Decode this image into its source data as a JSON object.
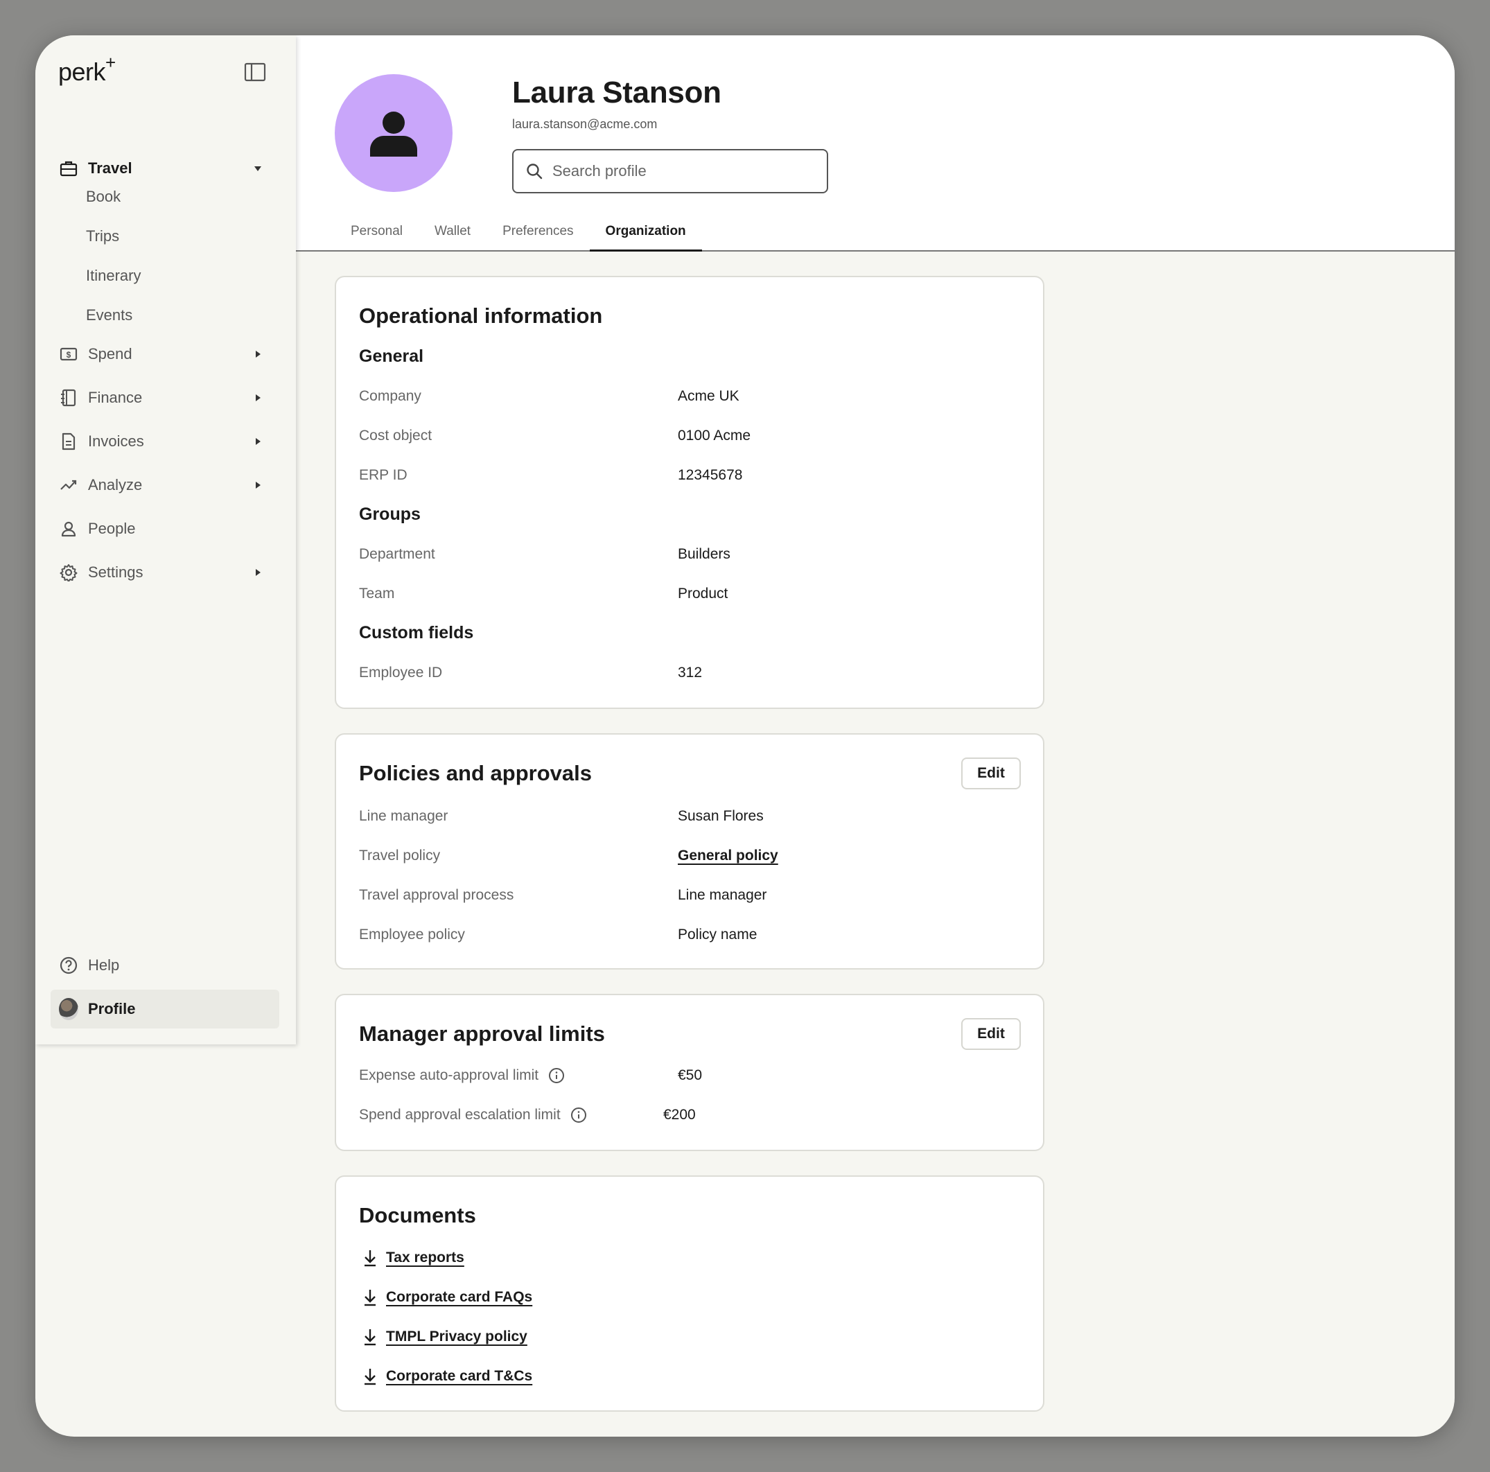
{
  "app": {
    "logo": "perk",
    "logo_mark": "+"
  },
  "sidebar": {
    "travel": {
      "label": "Travel",
      "sub": [
        "Book",
        "Trips",
        "Itinerary",
        "Events"
      ]
    },
    "items": [
      {
        "label": "Spend",
        "icon": "money-icon"
      },
      {
        "label": "Finance",
        "icon": "ledger-icon"
      },
      {
        "label": "Invoices",
        "icon": "document-icon"
      },
      {
        "label": "Analyze",
        "icon": "trend-icon"
      },
      {
        "label": "People",
        "icon": "person-icon"
      },
      {
        "label": "Settings",
        "icon": "gear-icon"
      }
    ],
    "help": "Help",
    "profile": "Profile"
  },
  "profile": {
    "name": "Laura Stanson",
    "email": "laura.stanson@acme.com",
    "search_placeholder": "Search profile",
    "tabs": [
      "Personal",
      "Wallet",
      "Preferences",
      "Organization"
    ],
    "active_tab": "Organization"
  },
  "operational": {
    "title": "Operational information",
    "general": {
      "title": "General",
      "rows": [
        {
          "label": "Company",
          "value": "Acme UK"
        },
        {
          "label": "Cost object",
          "value": "0100 Acme"
        },
        {
          "label": "ERP ID",
          "value": "12345678"
        }
      ]
    },
    "groups": {
      "title": "Groups",
      "rows": [
        {
          "label": "Department",
          "value": "Builders"
        },
        {
          "label": "Team",
          "value": "Product"
        }
      ]
    },
    "custom": {
      "title": "Custom fields",
      "rows": [
        {
          "label": "Employee ID",
          "value": "312"
        }
      ]
    }
  },
  "policies": {
    "title": "Policies and approvals",
    "edit": "Edit",
    "rows": [
      {
        "label": "Line manager",
        "value": "Susan Flores"
      },
      {
        "label": "Travel policy",
        "value": "General policy"
      },
      {
        "label": "Travel approval process",
        "value": "Line manager"
      },
      {
        "label": "Employee policy",
        "value": "Policy name"
      }
    ]
  },
  "limits": {
    "title": "Manager approval limits",
    "edit": "Edit",
    "rows": [
      {
        "label": "Expense auto-approval limit",
        "value": "€50"
      },
      {
        "label": "Spend approval escalation limit",
        "value": "€200"
      }
    ]
  },
  "documents": {
    "title": "Documents",
    "items": [
      "Tax reports",
      "Corporate card FAQs",
      "TMPL Privacy policy",
      "Corporate card T&Cs"
    ]
  },
  "colors": {
    "avatar_bg": "#c9a6fa",
    "page_bg": "#f6f6f1"
  }
}
